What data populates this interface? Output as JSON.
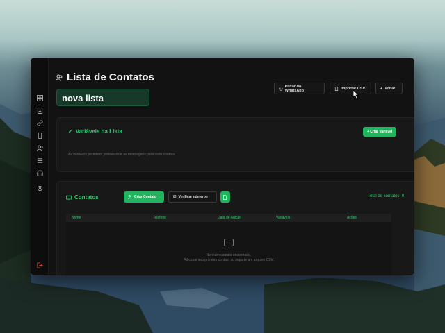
{
  "app": {
    "page_title": "Lista de Contatos",
    "list_name": "nova lista"
  },
  "header_buttons": {
    "whatsapp": "Puxar do WhatsApp",
    "import_csv": "Importar CSV",
    "back": "Voltar"
  },
  "variables_card": {
    "title": "Variáveis da Lista",
    "add_button": "+ Criar Variável",
    "description": "As variáveis permitem personalizar as mensagens para cada contato."
  },
  "contacts_card": {
    "title": "Contatos",
    "create_button": "Criar Contato",
    "verify_button": "Verificar números",
    "total_label": "Total de contatos: 0",
    "columns": [
      "Nome",
      "Telefone",
      "Data de Adição",
      "Variáveis",
      "Ações"
    ],
    "empty_title": "Nenhum contato encontrado.",
    "empty_hint": "Adicione seu primeiro contato ou importe um arquivo CSV."
  },
  "sidebar": {
    "icons": [
      "dashboard-icon",
      "document-icon",
      "link-icon",
      "phone-icon",
      "users-icon",
      "list-icon",
      "headset-icon",
      "settings-icon",
      "logout-icon"
    ]
  },
  "colors": {
    "accent": "#22b35e",
    "accent_text": "#2ecc71",
    "window_bg": "#121212",
    "logout": "#e0443a"
  }
}
